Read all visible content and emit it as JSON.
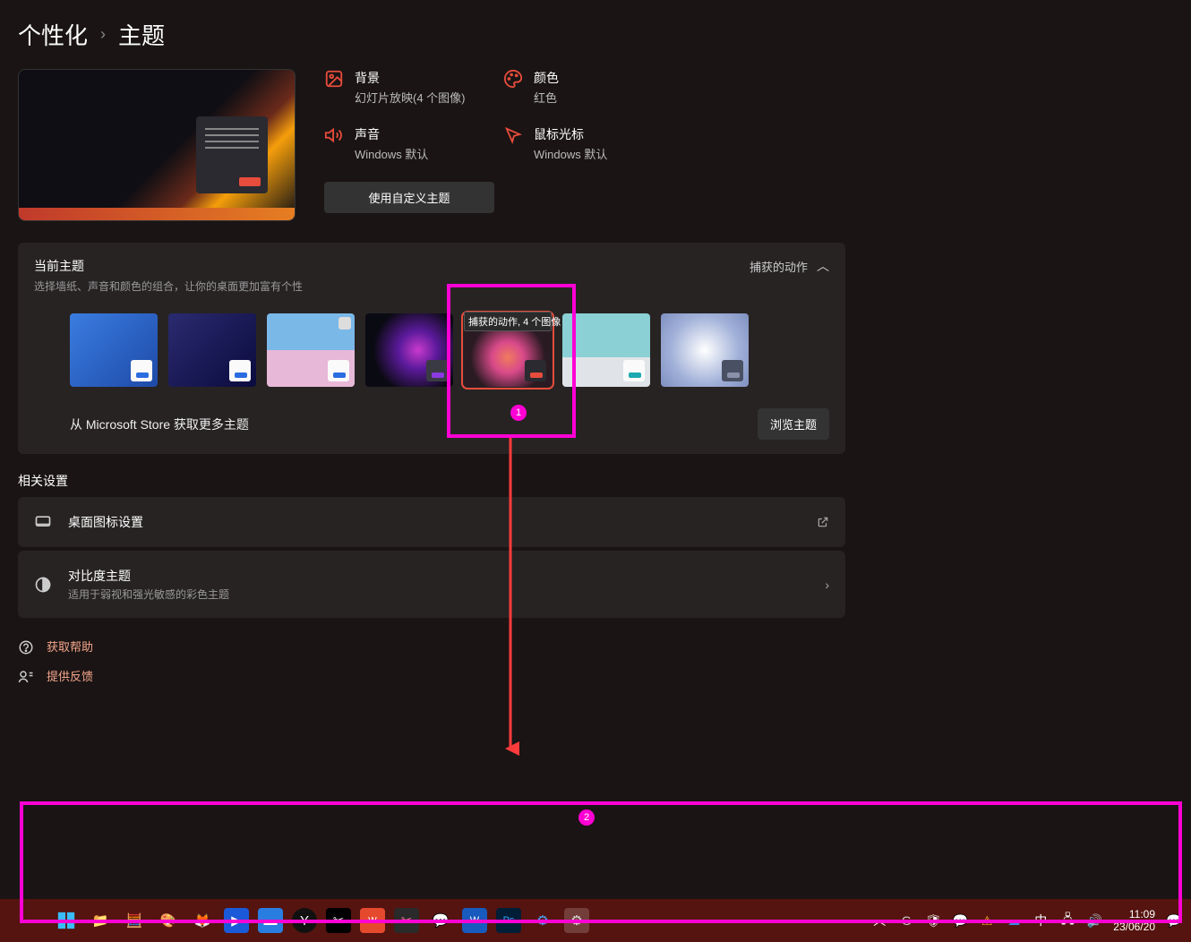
{
  "breadcrumb": {
    "parent": "个性化",
    "current": "主题"
  },
  "props": {
    "background": {
      "title": "背景",
      "value": "幻灯片放映(4 个图像)"
    },
    "color": {
      "title": "颜色",
      "value": "红色"
    },
    "sound": {
      "title": "声音",
      "value": "Windows 默认"
    },
    "cursor": {
      "title": "鼠标光标",
      "value": "Windows 默认"
    },
    "use_custom_btn": "使用自定义主题"
  },
  "current_theme_card": {
    "title": "当前主题",
    "subtitle": "选择墙纸、声音和颜色的组合，让你的桌面更加富有个性",
    "collapse_label": "捕获的动作",
    "tooltip": "捕获的动作, 4 个图像",
    "footer_link": "从 Microsoft Store 获取更多主题",
    "browse_btn": "浏览主题"
  },
  "related_title": "相关设置",
  "rows": {
    "desktop_icons": {
      "title": "桌面图标设置"
    },
    "contrast": {
      "title": "对比度主题",
      "sub": "适用于弱视和强光敏感的彩色主题"
    }
  },
  "help": {
    "get_help": "获取帮助",
    "feedback": "提供反馈"
  },
  "annotations": {
    "a1": "1",
    "a2": "2"
  },
  "tray": {
    "ime": "中",
    "time": "11:09",
    "date": "23/06/20"
  }
}
